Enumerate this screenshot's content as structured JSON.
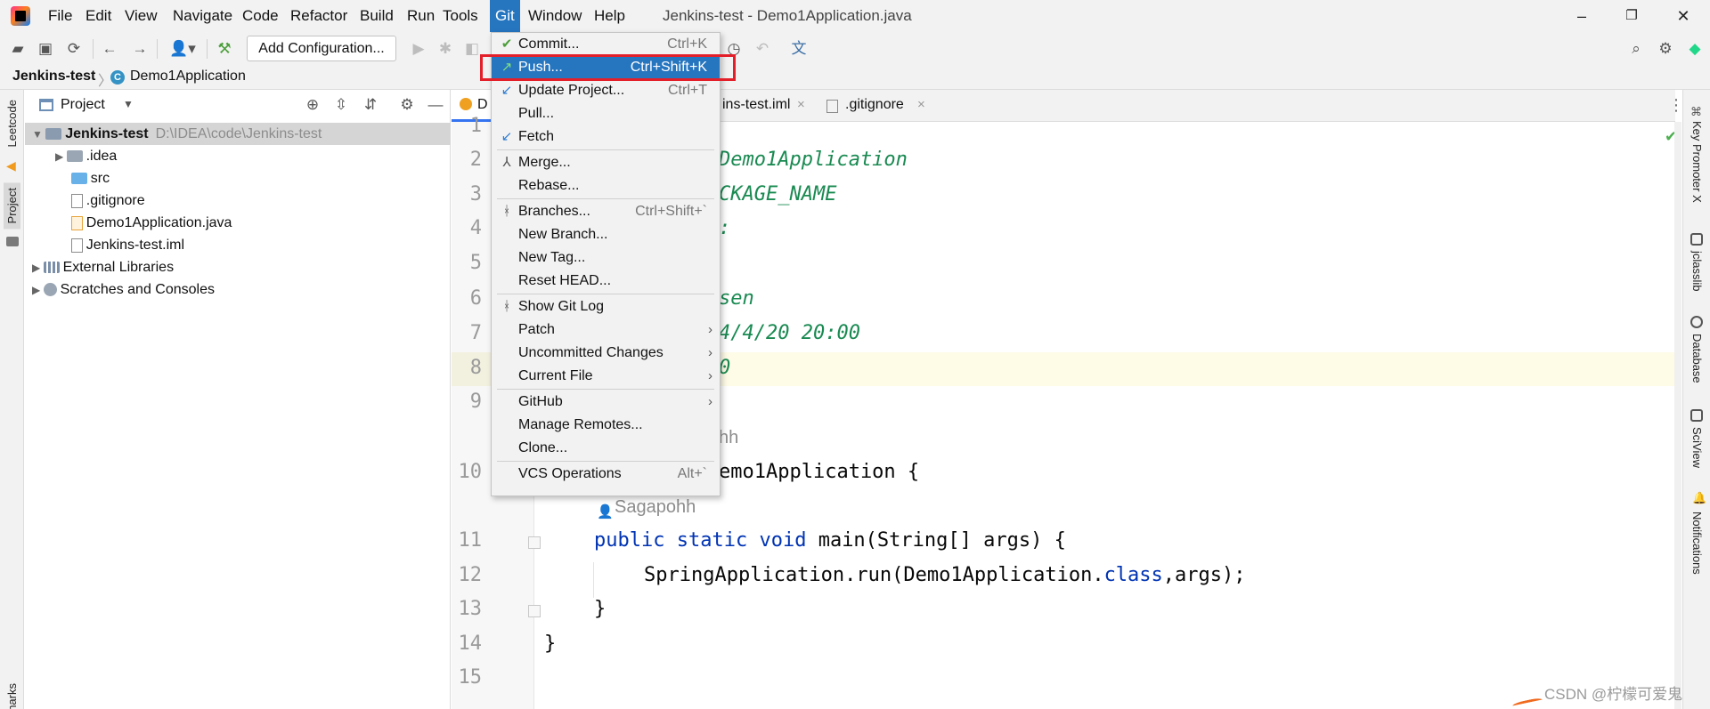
{
  "menubar": {
    "items": [
      "File",
      "Edit",
      "View",
      "Navigate",
      "Code",
      "Refactor",
      "Build",
      "Run",
      "Tools",
      "Git",
      "Window",
      "Help"
    ],
    "active": "Git",
    "window_title": "Jenkins-test - Demo1Application.java",
    "controls": {
      "minimize": "–",
      "restore": "❐",
      "close": "✕"
    }
  },
  "toolbar": {
    "add_configuration": "Add Configuration...",
    "icons": [
      "open-folder-icon",
      "save-icon",
      "sync-icon",
      "back-icon",
      "forward-icon",
      "vcs-user-icon",
      "build-hammer-icon",
      "run-icon",
      "debug-icon",
      "coverage-icon",
      "history-icon",
      "rollback-icon",
      "translate-icon",
      "search-icon",
      "settings-icon",
      "toolbox-icon"
    ]
  },
  "breadcrumb": {
    "project": "Jenkins-test",
    "file": "Demo1Application",
    "class_badge": "C"
  },
  "left_stripe": {
    "leetcode": "Leetcode",
    "project": "Project",
    "bookmarks": "Bookmarks"
  },
  "project_panel": {
    "title": "Project",
    "tree": [
      {
        "label": "Jenkins-test",
        "path": "D:\\IDEA\\code\\Jenkins-test",
        "level": 0,
        "expanded": true,
        "type": "module"
      },
      {
        "label": ".idea",
        "level": 1,
        "expanded": false,
        "type": "folder"
      },
      {
        "label": "src",
        "level": 1,
        "type": "folder-src"
      },
      {
        "label": ".gitignore",
        "level": 1,
        "type": "file"
      },
      {
        "label": "Demo1Application.java",
        "level": 1,
        "type": "java"
      },
      {
        "label": "Jenkins-test.iml",
        "level": 1,
        "type": "iml"
      },
      {
        "label": "External Libraries",
        "level": 0,
        "expanded": false,
        "type": "libs"
      },
      {
        "label": "Scratches and Consoles",
        "level": 0,
        "expanded": false,
        "type": "scratches"
      }
    ]
  },
  "editor_tabs": {
    "active_fragment": "D",
    "tabs": [
      {
        "label": "ins-test.iml",
        "close": "×"
      },
      {
        "label": ".gitignore",
        "close": "×"
      }
    ],
    "more": "⋮"
  },
  "editor": {
    "lines": [
      {
        "n": "1",
        "text": ""
      },
      {
        "n": "2",
        "text": "Demo1Application"
      },
      {
        "n": "3",
        "text": "CKAGE_NAME"
      },
      {
        "n": "4",
        "text": ":"
      },
      {
        "n": "5",
        "text": ""
      },
      {
        "n": "6",
        "text": "sen"
      },
      {
        "n": "7",
        "text": "4/4/20 20:00"
      },
      {
        "n": "8",
        "text": "0"
      },
      {
        "n": "9",
        "text": ""
      },
      {
        "n": "10",
        "text": "emo1Application {"
      },
      {
        "n": "11",
        "text": "public static void main(String[] args) {"
      },
      {
        "n": "12",
        "text": "SpringApplication.run(Demo1Application.class,args);"
      },
      {
        "n": "13",
        "text": "}"
      },
      {
        "n": "14",
        "text": "}"
      },
      {
        "n": "15",
        "text": ""
      }
    ],
    "inlay_author_1": "hh",
    "inlay_author_2": "Sagapohh",
    "line11": {
      "kw1": "public",
      "kw2": "static",
      "kw3": "void",
      "rest": " main(String[] args) {"
    },
    "line12": {
      "pre": "SpringApplication.run(Demo1Application.",
      "kw": "class",
      "post": ",args);"
    }
  },
  "right_stripe": [
    "Key Promoter X",
    "jclasslib",
    "Database",
    "SciView",
    "Notifications"
  ],
  "git_menu": {
    "items": [
      {
        "label": "Commit...",
        "shortcut": "Ctrl+K",
        "icon": "✔",
        "icon_name": "commit-check-icon",
        "icon_class": "ico-check"
      },
      {
        "label": "Push...",
        "shortcut": "Ctrl+Shift+K",
        "icon": "↗",
        "icon_name": "push-arrow-icon",
        "icon_class": "ico-push",
        "selected": true
      },
      {
        "label": "Update Project...",
        "shortcut": "Ctrl+T",
        "icon": "↙",
        "icon_name": "update-arrow-icon",
        "icon_class": "ico-blue"
      },
      {
        "label": "Pull...",
        "shortcut": ""
      },
      {
        "label": "Fetch",
        "shortcut": "",
        "icon": "↙",
        "icon_name": "fetch-arrow-icon",
        "icon_class": "ico-blue"
      },
      {
        "sep": true
      },
      {
        "label": "Merge...",
        "shortcut": "",
        "icon": "⅄",
        "icon_name": "merge-icon",
        "icon_class": "ico-gray"
      },
      {
        "label": "Rebase...",
        "shortcut": ""
      },
      {
        "sep": true
      },
      {
        "label": "Branches...",
        "shortcut": "Ctrl+Shift+`",
        "icon": "ᚼ",
        "icon_name": "branch-icon",
        "icon_class": "ico-gray"
      },
      {
        "label": "New Branch...",
        "shortcut": ""
      },
      {
        "label": "New Tag...",
        "shortcut": ""
      },
      {
        "label": "Reset HEAD...",
        "shortcut": ""
      },
      {
        "sep": true
      },
      {
        "label": "Show Git Log",
        "shortcut": "",
        "icon": "ᚼ",
        "icon_name": "git-log-icon",
        "icon_class": "ico-gray"
      },
      {
        "label": "Patch",
        "shortcut": "",
        "sub": true
      },
      {
        "label": "Uncommitted Changes",
        "shortcut": "",
        "sub": true
      },
      {
        "label": "Current File",
        "shortcut": "",
        "sub": true
      },
      {
        "sep": true
      },
      {
        "label": "GitHub",
        "shortcut": "",
        "sub": true
      },
      {
        "label": "Manage Remotes...",
        "shortcut": ""
      },
      {
        "label": "Clone...",
        "shortcut": ""
      },
      {
        "sep": true
      },
      {
        "label": "VCS Operations",
        "shortcut": "Alt+`"
      }
    ]
  },
  "watermark": "CSDN @柠檬可爱鬼",
  "colors": {
    "accent": "#2675bf",
    "highlight_box": "#e3202a",
    "doc_comment": "#1a8a52",
    "keyword": "#0033b3"
  }
}
